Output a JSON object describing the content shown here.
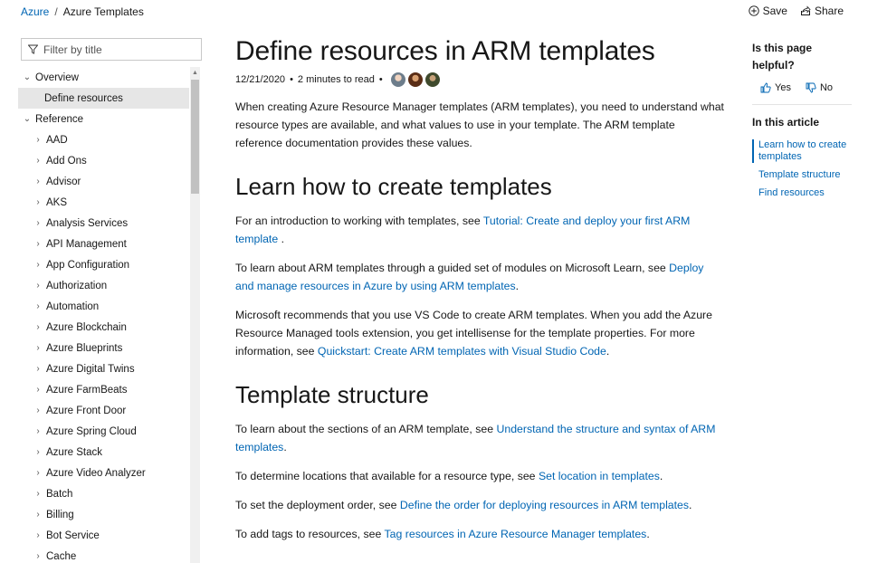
{
  "breadcrumb": {
    "items": [
      "Azure",
      "Azure Templates"
    ],
    "separator": "/"
  },
  "actions": {
    "save_label": "Save",
    "share_label": "Share"
  },
  "filter": {
    "placeholder": "Filter by title"
  },
  "toc": {
    "overview_label": "Overview",
    "selected_label": "Define resources",
    "reference_label": "Reference",
    "reference_items": [
      "AAD",
      "Add Ons",
      "Advisor",
      "AKS",
      "Analysis Services",
      "API Management",
      "App Configuration",
      "Authorization",
      "Automation",
      "Azure Blockchain",
      "Azure Blueprints",
      "Azure Digital Twins",
      "Azure FarmBeats",
      "Azure Front Door",
      "Azure Spring Cloud",
      "Azure Stack",
      "Azure Video Analyzer",
      "Batch",
      "Billing",
      "Bot Service",
      "Cache"
    ]
  },
  "article": {
    "title": "Define resources in ARM templates",
    "date": "12/21/2020",
    "read_time": "2 minutes to read",
    "intro": "When creating Azure Resource Manager templates (ARM templates), you need to understand what resource types are available, and what values to use in your template. The ARM template reference documentation provides these values.",
    "section1": {
      "heading": "Learn how to create templates",
      "p1_pre": "For an introduction to working with templates, see ",
      "p1_link": "Tutorial: Create and deploy your first ARM template",
      "p1_post": " .",
      "p2_pre": "To learn about ARM templates through a guided set of modules on Microsoft Learn, see ",
      "p2_link": "Deploy and manage resources in Azure by using ARM templates",
      "p2_post": ".",
      "p3_pre": "Microsoft recommends that you use VS Code to create ARM templates. When you add the Azure Resource Managed tools extension, you get intellisense for the template properties. For more information, see ",
      "p3_link": "Quickstart: Create ARM templates with Visual Studio Code",
      "p3_post": "."
    },
    "section2": {
      "heading": "Template structure",
      "p1_pre": "To learn about the sections of an ARM template, see ",
      "p1_link": "Understand the structure and syntax of ARM templates",
      "p1_post": ".",
      "p2_pre": "To determine locations that available for a resource type, see ",
      "p2_link": "Set location in templates",
      "p2_post": ".",
      "p3_pre": "To set the deployment order, see ",
      "p3_link": "Define the order for deploying resources in ARM templates",
      "p3_post": ".",
      "p4_pre": "To add tags to resources, see ",
      "p4_link": "Tag resources in Azure Resource Manager templates",
      "p4_post": "."
    }
  },
  "rail": {
    "helpful_question": "Is this page helpful?",
    "yes_label": "Yes",
    "no_label": "No",
    "in_article_label": "In this article",
    "links": [
      "Learn how to create templates",
      "Template structure",
      "Find resources"
    ]
  },
  "colors": {
    "link": "#0065b3",
    "selected_bg": "#e6e6e6"
  }
}
